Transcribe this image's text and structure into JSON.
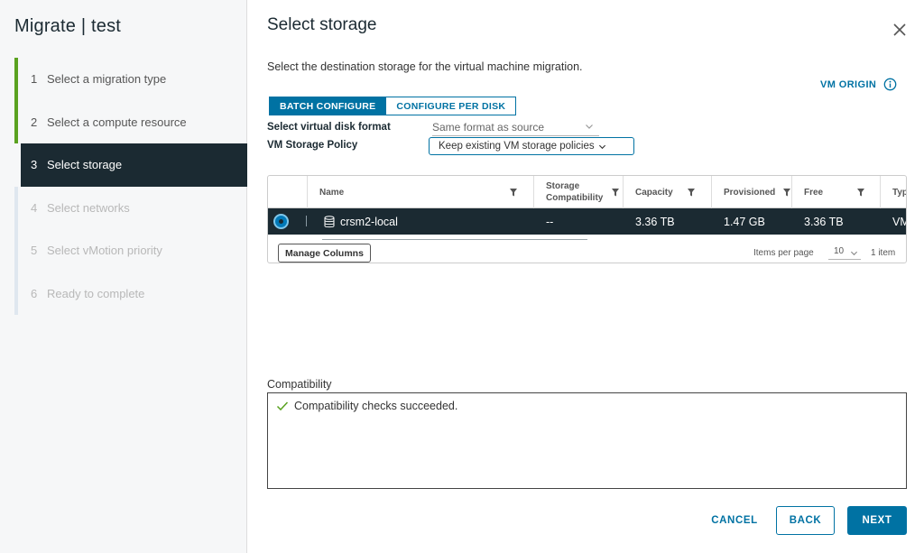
{
  "wizard": {
    "title": "Migrate | test",
    "steps": [
      {
        "num": "1",
        "label": "Select a migration type",
        "state": "done"
      },
      {
        "num": "2",
        "label": "Select a compute resource",
        "state": "done"
      },
      {
        "num": "3",
        "label": "Select storage",
        "state": "active"
      },
      {
        "num": "4",
        "label": "Select networks",
        "state": "pending"
      },
      {
        "num": "5",
        "label": "Select vMotion priority",
        "state": "pending"
      },
      {
        "num": "6",
        "label": "Ready to complete",
        "state": "pending"
      }
    ]
  },
  "main": {
    "title": "Select storage",
    "description": "Select the destination storage for the virtual machine migration.",
    "vm_origin_label": "VM ORIGIN",
    "tabs": {
      "batch": "BATCH CONFIGURE",
      "per_disk": "CONFIGURE PER DISK"
    },
    "disk_format": {
      "label": "Select virtual disk format",
      "value": "Same format as source"
    },
    "storage_policy": {
      "label": "VM Storage Policy",
      "value": "Keep existing VM storage policies"
    }
  },
  "grid": {
    "columns": {
      "name": "Name",
      "storage_compat_line1": "Storage",
      "storage_compat_line2": "Compatibility",
      "capacity": "Capacity",
      "provisioned": "Provisioned",
      "free": "Free",
      "type": "Typ"
    },
    "row": {
      "name": "crsm2-local",
      "storage_compat": "--",
      "capacity": "3.36 TB",
      "provisioned": "1.47 GB",
      "free": "3.36 TB",
      "type": "VM"
    },
    "manage_columns": "Manage Columns",
    "items_per_page_label": "Items per page",
    "items_per_page_value": "10",
    "item_count": "1 item"
  },
  "compatibility": {
    "label": "Compatibility",
    "message": "Compatibility checks succeeded."
  },
  "footer": {
    "cancel": "CANCEL",
    "back": "BACK",
    "next": "NEXT"
  },
  "colors": {
    "accent": "#0072a3",
    "dark": "#1b2a32",
    "done": "#5aa220",
    "success": "#5aa220"
  }
}
